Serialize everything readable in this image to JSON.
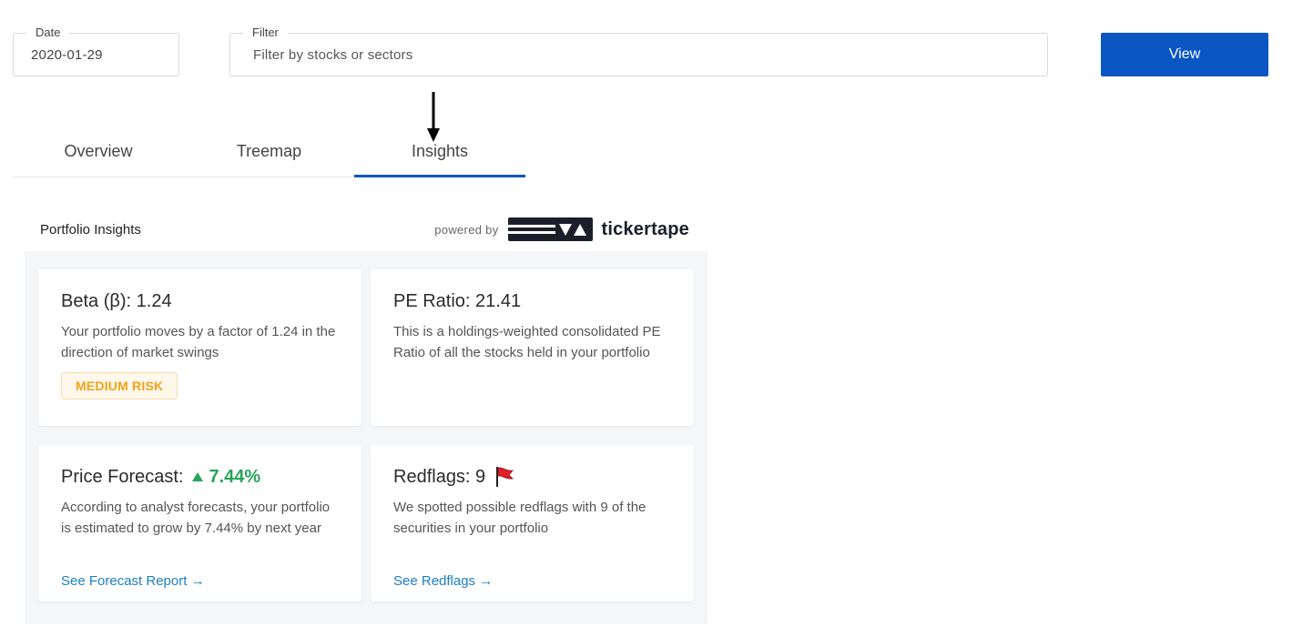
{
  "filters": {
    "date_label": "Date",
    "date_value": "2020-01-29",
    "filter_label": "Filter",
    "filter_placeholder": "Filter by stocks or sectors",
    "view_label": "View"
  },
  "tabs": [
    {
      "label": "Overview",
      "active": false
    },
    {
      "label": "Treemap",
      "active": false
    },
    {
      "label": "Insights",
      "active": true
    }
  ],
  "insights": {
    "title": "Portfolio Insights",
    "powered_by": "powered by",
    "brand": "tickertape",
    "cards": {
      "beta": {
        "title": "Beta (β): 1.24",
        "description": "Your portfolio moves by a factor of 1.24 in the direction of market swings",
        "badge": "MEDIUM RISK"
      },
      "pe": {
        "title": "PE Ratio: 21.41",
        "description": "This is a holdings-weighted consolidated PE Ratio of all the stocks held in your portfolio"
      },
      "forecast": {
        "title": "Price Forecast:",
        "value": "7.44%",
        "description": "According to analyst forecasts, your portfolio is estimated to grow by 7.44% by next year",
        "link": "See Forecast Report →"
      },
      "redflags": {
        "title": "Redflags: 9",
        "description": "We spotted possible redflags with 9 of the securities in your portfolio",
        "link": "See Redflags →"
      }
    }
  },
  "colors": {
    "primary": "#0a56c2",
    "positive": "#27a55a",
    "warning": "#f2a21b",
    "link": "#1a7fc4",
    "flag": "#e0202a"
  },
  "icons": {
    "arrow": "down-arrow-icon",
    "brand_logo": "tickertape-logo-icon",
    "forecast": "triangle-up-icon",
    "redflag": "red-flag-icon"
  }
}
